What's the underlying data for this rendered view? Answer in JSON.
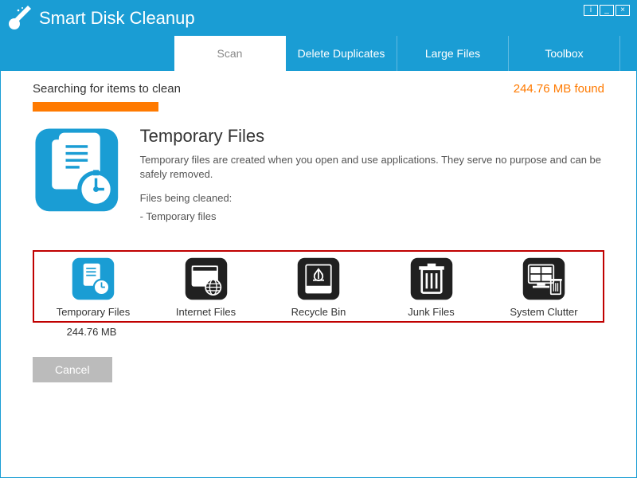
{
  "app": {
    "title": "Smart Disk Cleanup"
  },
  "tabs": {
    "scan": "Scan",
    "duplicates": "Delete Duplicates",
    "large": "Large Files",
    "toolbox": "Toolbox"
  },
  "status": {
    "searching": "Searching for items to clean",
    "found": "244.76 MB found"
  },
  "detail": {
    "title": "Temporary Files",
    "desc": "Temporary files are created when you open and use applications. They serve no purpose and can be safely removed.",
    "being_cleaned_label": "Files being cleaned:",
    "being_cleaned_item": "- Temporary files"
  },
  "categories": {
    "temp": {
      "label": "Temporary Files",
      "size": "244.76 MB"
    },
    "internet": {
      "label": "Internet Files"
    },
    "recycle": {
      "label": "Recycle Bin"
    },
    "junk": {
      "label": "Junk Files"
    },
    "system": {
      "label": "System Clutter"
    }
  },
  "buttons": {
    "cancel": "Cancel"
  },
  "colors": {
    "accent": "#1a9dd4",
    "highlight": "#ff7a00"
  }
}
